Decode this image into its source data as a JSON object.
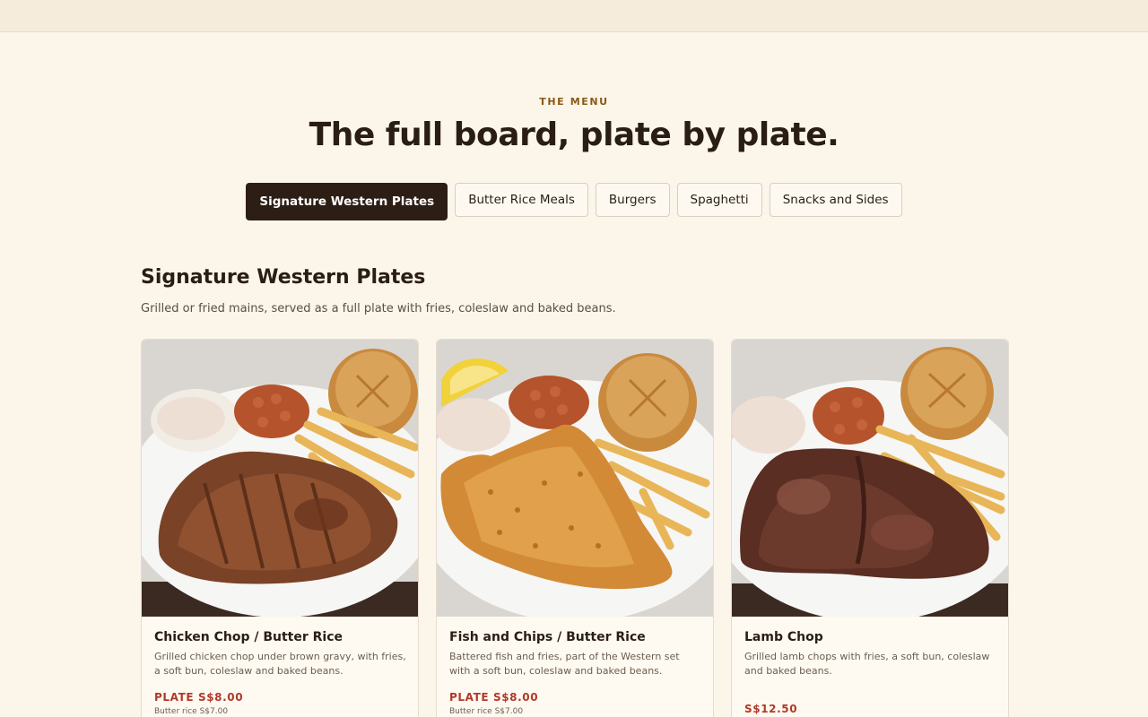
{
  "header": {
    "eyebrow": "THE MENU",
    "title": "The full board, plate by plate."
  },
  "tabs": [
    {
      "label": "Signature Western Plates",
      "active": true
    },
    {
      "label": "Butter Rice Meals",
      "active": false
    },
    {
      "label": "Burgers",
      "active": false
    },
    {
      "label": "Spaghetti",
      "active": false
    },
    {
      "label": "Snacks and Sides",
      "active": false
    }
  ],
  "section": {
    "title": "Signature Western Plates",
    "description": "Grilled or fried mains, served as a full plate with fries, coleslaw and baked beans."
  },
  "items": [
    {
      "name": "Chicken Chop / Butter Rice",
      "description": "Grilled chicken chop under brown gravy, with fries, a soft bun, coleslaw and baked beans.",
      "price": "PLATE S$8.00",
      "sub_price": "Butter rice S$7.00",
      "image": "chicken-chop-plate"
    },
    {
      "name": "Fish and Chips / Butter Rice",
      "description": "Battered fish and fries, part of the Western set with a soft bun, coleslaw and baked beans.",
      "price": "PLATE S$8.00",
      "sub_price": "Butter rice S$7.00",
      "image": "fish-and-chips-plate"
    },
    {
      "name": "Lamb Chop",
      "description": "Grilled lamb chops with fries, a soft bun, coleslaw and baked beans.",
      "price": "S$12.50",
      "image": "lamb-chop-plate"
    }
  ],
  "colors": {
    "background": "#fbf5ea",
    "accent_dark": "#2d1e15",
    "price_red": "#b0392b",
    "eyebrow_gold": "#8a5a16"
  }
}
